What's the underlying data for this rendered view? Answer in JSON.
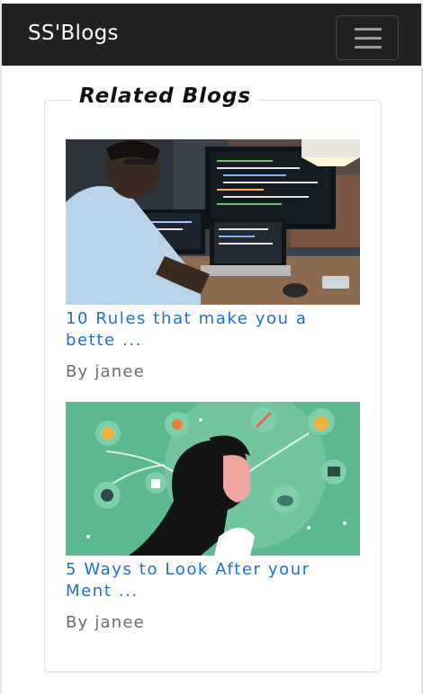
{
  "navbar": {
    "brand": "SS'Blogs",
    "toggle_icon": "hamburger-menu-icon"
  },
  "section": {
    "legend": "Related Blogs"
  },
  "posts": [
    {
      "title": "10 Rules that make you a bette ...",
      "author": "By janee",
      "image": "man-coding-at-desk-photo"
    },
    {
      "title": "5 Ways to Look After your Ment ...",
      "author": "By janee",
      "image": "woman-mental-health-illustration"
    }
  ],
  "colors": {
    "navbar_bg": "#212121",
    "link": "#1c6fe0",
    "muted_text": "#6c6c6c",
    "illustration_bg": "#5cb88f"
  }
}
